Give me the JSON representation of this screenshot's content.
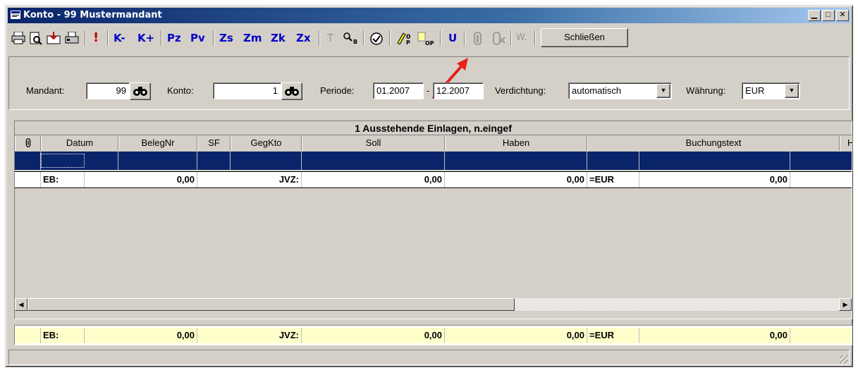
{
  "window": {
    "title": "Konto - 99 Mustermandant"
  },
  "toolbar": {
    "k_minus": "K-",
    "k_plus": "K+",
    "pz": "Pz",
    "pv": "Pv",
    "zs": "Zs",
    "zm": "Zm",
    "zk": "Zk",
    "zx": "Zx",
    "t": "T",
    "u": "U",
    "w": "W.",
    "close_label": "Schließen"
  },
  "filters": {
    "mandant_label": "Mandant:",
    "mandant_value": "99",
    "konto_label": "Konto:",
    "konto_value": "1",
    "periode_label": "Periode:",
    "periode_from": "01.2007",
    "periode_sep": "-",
    "periode_to": "12.2007",
    "verdichtung_label": "Verdichtung:",
    "verdichtung_value": "automatisch",
    "waehrung_label": "Währung:",
    "waehrung_value": "EUR"
  },
  "grid": {
    "title": "1   Ausstehende Einlagen, n.eingef",
    "columns": [
      "Datum",
      "BelegNr",
      "SF",
      "GegKto",
      "Soll",
      "Haben",
      "Buchungstext",
      "H"
    ],
    "summary_row": {
      "eb_label": "EB:",
      "eb_value": "0,00",
      "jvz_label": "JVZ:",
      "soll": "0,00",
      "haben": "0,00",
      "currency": "=EUR",
      "total": "0,00"
    }
  },
  "footer": {
    "eb_label": "EB:",
    "eb_value": "0,00",
    "jvz_label": "JVZ:",
    "soll": "0,00",
    "haben": "0,00",
    "currency": "=EUR",
    "total": "0,00"
  },
  "colors": {
    "selection": "#0a246a",
    "footer_bg": "#ffffcc",
    "annotation_arrow": "#e8201a"
  }
}
